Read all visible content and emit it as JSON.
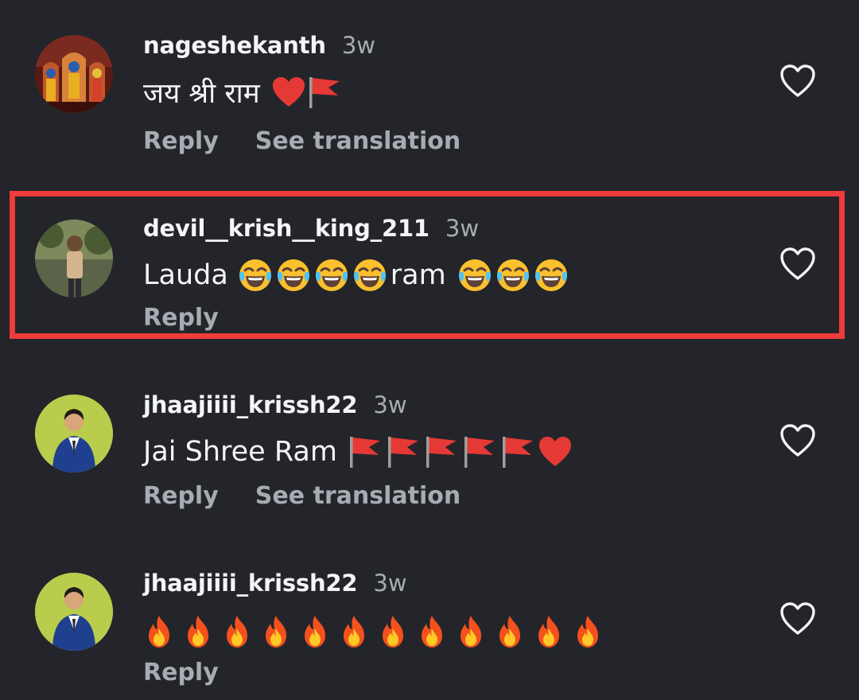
{
  "comments": [
    {
      "username": "nageshekanth",
      "time": "3w",
      "text": "जय श्री राम",
      "actions": [
        "Reply",
        "See translation"
      ]
    },
    {
      "username": "devil__krish__king_211",
      "time": "3w",
      "text_before": "Lauda",
      "text_after": "ram",
      "actions": [
        "Reply"
      ],
      "highlighted": true
    },
    {
      "username": "jhaajiiii_krissh22",
      "time": "3w",
      "text": "Jai Shree Ram",
      "actions": [
        "Reply",
        "See translation"
      ]
    },
    {
      "username": "jhaajiiii_krissh22",
      "time": "3w",
      "text": "",
      "actions": [
        "Reply"
      ]
    }
  ],
  "icons": {
    "like": "heart-outline-icon",
    "laugh": "face-with-tears-of-joy-emoji",
    "flag": "triangular-flag-emoji",
    "heart": "red-heart-emoji",
    "fire": "fire-emoji"
  },
  "colors": {
    "background": "#23252a",
    "text": "#f3f5f7",
    "muted": "#a8abb1",
    "highlight": "#ee3b3b"
  }
}
